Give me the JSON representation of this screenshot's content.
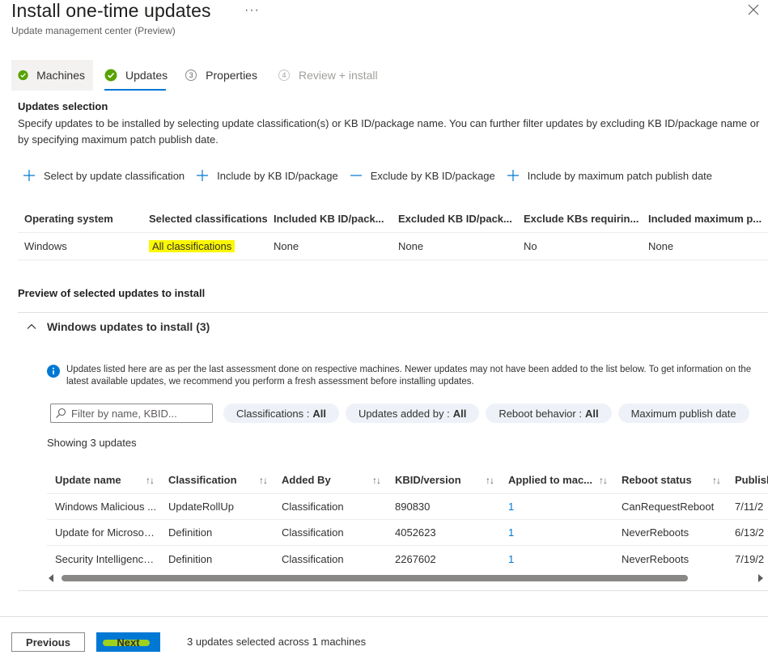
{
  "header": {
    "title": "Install one-time updates",
    "more": "···",
    "subtitle": "Update management center (Preview)"
  },
  "steps": [
    {
      "label": "Machines",
      "state": "done"
    },
    {
      "label": "Updates",
      "state": "done-active"
    },
    {
      "label": "Properties",
      "number": "3",
      "state": "pending"
    },
    {
      "label": "Review + install",
      "number": "4",
      "state": "disabled"
    }
  ],
  "updates_selection": {
    "title": "Updates selection",
    "description": "Specify updates to be installed by selecting update classification(s) or KB ID/package name. You can further filter updates by excluding KB ID/package name or by specifying maximum patch publish date.",
    "actions": [
      {
        "label": "Select by update classification",
        "icon": "plus-icon"
      },
      {
        "label": "Include by KB ID/package",
        "icon": "plus-icon"
      },
      {
        "label": "Exclude by KB ID/package",
        "icon": "minus-icon"
      },
      {
        "label": "Include by maximum patch publish date",
        "icon": "plus-icon"
      }
    ],
    "columns": [
      "Operating system",
      "Selected classifications",
      "Included KB ID/pack...",
      "Excluded KB ID/pack...",
      "Exclude KBs requirin...",
      "Included maximum p..."
    ],
    "row": [
      "Windows",
      "All classifications",
      "None",
      "None",
      "No",
      "None"
    ]
  },
  "preview": {
    "title": "Preview of selected updates to install",
    "accordion_label": "Windows updates to install (3)",
    "info_text": "Updates listed here are as per the last assessment done on respective machines. Newer updates may not have been added to the list below. To get information on the latest available updates, we recommend you perform a fresh assessment before installing updates.",
    "search_placeholder": "Filter by name, KBID...",
    "filters": [
      {
        "label": "Classifications :",
        "value": "All"
      },
      {
        "label": "Updates added by :",
        "value": "All"
      },
      {
        "label": "Reboot behavior :",
        "value": "All"
      },
      {
        "label": "Maximum publish date",
        "value": ""
      }
    ],
    "showing": "Showing 3 updates",
    "columns": [
      "Update name",
      "Classification",
      "Added By",
      "KBID/version",
      "Applied to mac...",
      "Reboot status",
      "Publish"
    ],
    "rows": [
      [
        "Windows Malicious ...",
        "UpdateRollUp",
        "Classification",
        "890830",
        "1",
        "CanRequestReboot",
        "7/11/2"
      ],
      [
        "Update for Microsoft...",
        "Definition",
        "Classification",
        "4052623",
        "1",
        "NeverReboots",
        "6/13/2"
      ],
      [
        "Security Intelligence ...",
        "Definition",
        "Classification",
        "2267602",
        "1",
        "NeverReboots",
        "7/19/2"
      ]
    ]
  },
  "footer": {
    "previous": "Previous",
    "next": "Next",
    "status": "3 updates selected across 1 machines"
  },
  "colors": {
    "accent": "#0078d4",
    "success": "#107c10",
    "highlight": "#fbf700",
    "pill_bg": "#eef2f8"
  }
}
